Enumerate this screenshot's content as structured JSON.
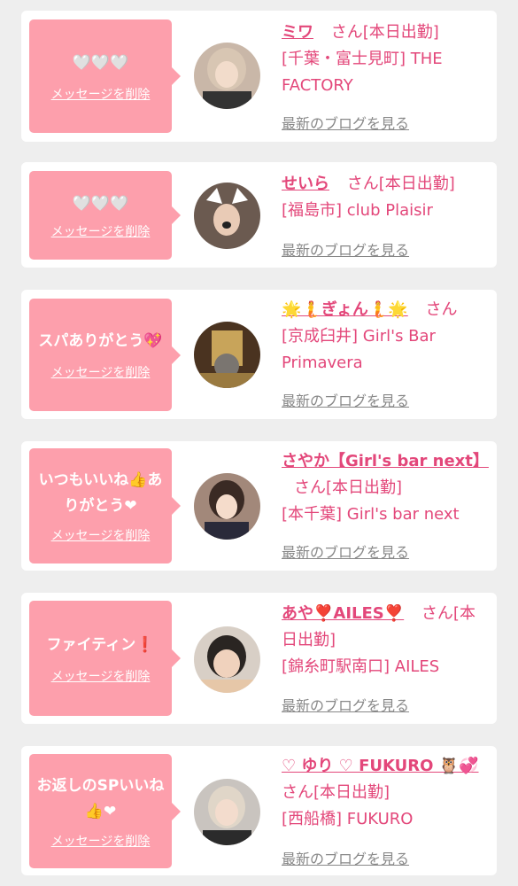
{
  "delete_label": "メッセージを削除",
  "blog_label": "最新のブログを見る",
  "san_suffix": "さん",
  "cards": [
    {
      "message": "🤍🤍🤍",
      "name": "ミワ",
      "status": "[本日出勤]",
      "place": "[千葉・富士見町] THE FACTORY"
    },
    {
      "message": "🤍🤍🤍",
      "name": "せいら",
      "status": "[本日出勤]",
      "place": "[福島市] club Plaisir"
    },
    {
      "message": "スパありがとう💖",
      "name": "🌟🧜ぎょん🧜🌟",
      "status": "",
      "place": "[京成臼井] Girl's Bar Primavera"
    },
    {
      "message": "いつもいいね👍ありがとう❤",
      "name": "さやか【Girl's bar next】",
      "status": "[本日出勤]",
      "place": "[本千葉] Girl's bar next"
    },
    {
      "message": "ファイティン❗️",
      "name": "あや❣️AILES❣️",
      "status": "[本日出勤]",
      "place": "[錦糸町駅南口] AILES"
    },
    {
      "message": "お返しのSPいいね👍❤",
      "name": "♡ ゆり ♡ FUKURO 🦉💞",
      "status": "[本日出勤]",
      "place": "[西船橋] FUKURO"
    }
  ],
  "colors": {
    "accent": "#e3477a",
    "bubble": "#fd9fac",
    "background": "#eeeeee",
    "link_gray": "#888888"
  },
  "icons": [
    "avatar-photo"
  ]
}
